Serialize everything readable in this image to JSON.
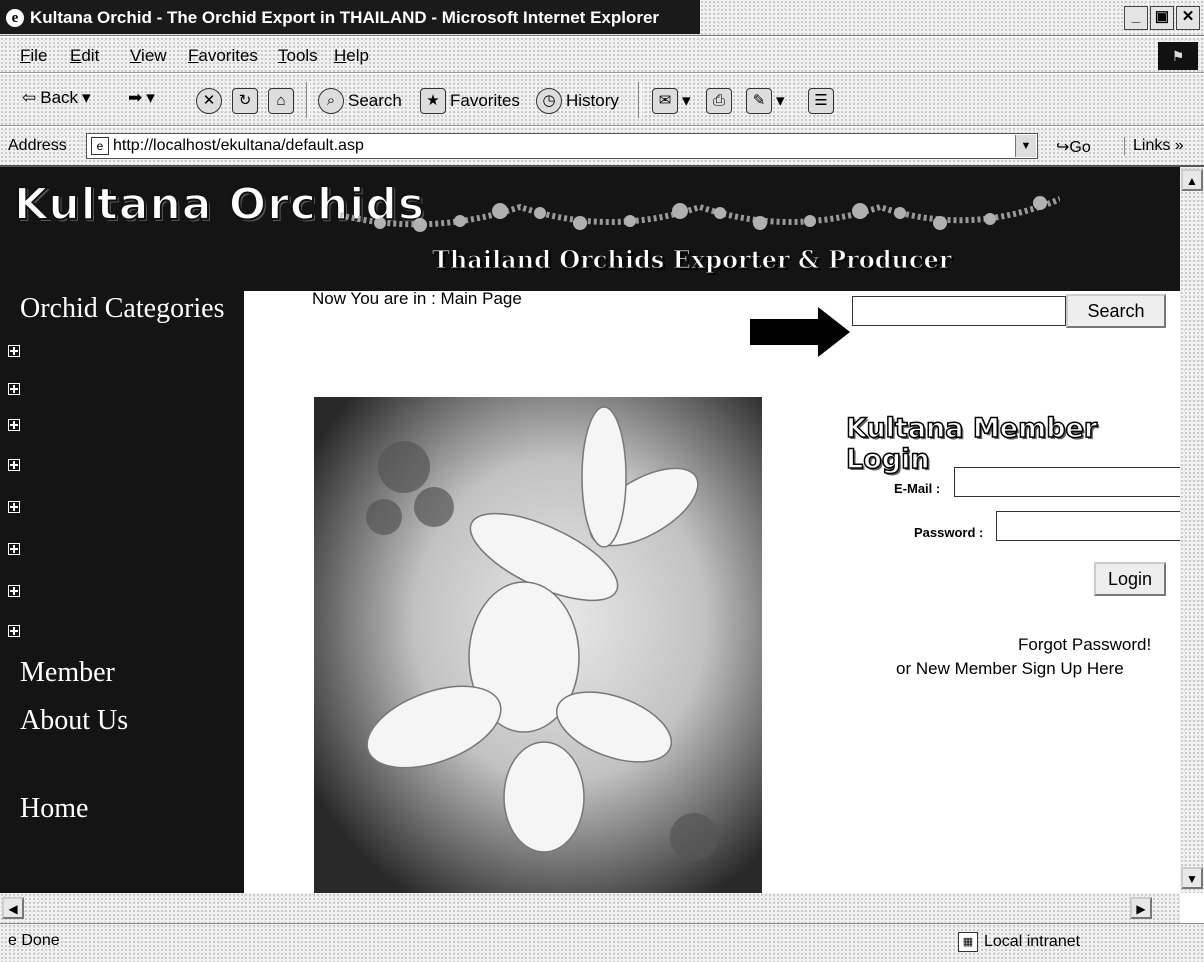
{
  "window": {
    "title": "Kultana Orchid - The Orchid Export in THAILAND - Microsoft Internet Explorer",
    "icon": "e",
    "buttons": {
      "minimize": "_",
      "maximize": "▣",
      "close": "✕"
    }
  },
  "menu": [
    "File",
    "Edit",
    "View",
    "Favorites",
    "Tools",
    "Help"
  ],
  "toolbar": {
    "back": "Back",
    "search": "Search",
    "favorites": "Favorites",
    "history": "History"
  },
  "address": {
    "label": "Address",
    "url": "http://localhost/ekultana/default.asp",
    "go": "Go",
    "links": "Links"
  },
  "page": {
    "site_title": "Kultana Orchids",
    "tagline": "Thailand Orchids Exporter & Producer",
    "sidebar": {
      "categories_title": "Orchid Categories",
      "category_count": 8,
      "links": [
        "Member",
        "About Us",
        "Home"
      ]
    },
    "breadcrumb": "Now You are in : Main Page",
    "search": {
      "button": "Search",
      "value": ""
    },
    "login": {
      "title": "Kultana Member Login",
      "email_label": "E-Mail :",
      "password_label": "Password :",
      "button": "Login",
      "forgot": "Forgot Password!",
      "signup": "or New Member Sign Up Here"
    }
  },
  "status": {
    "text": "Done",
    "zone": "Local intranet"
  }
}
